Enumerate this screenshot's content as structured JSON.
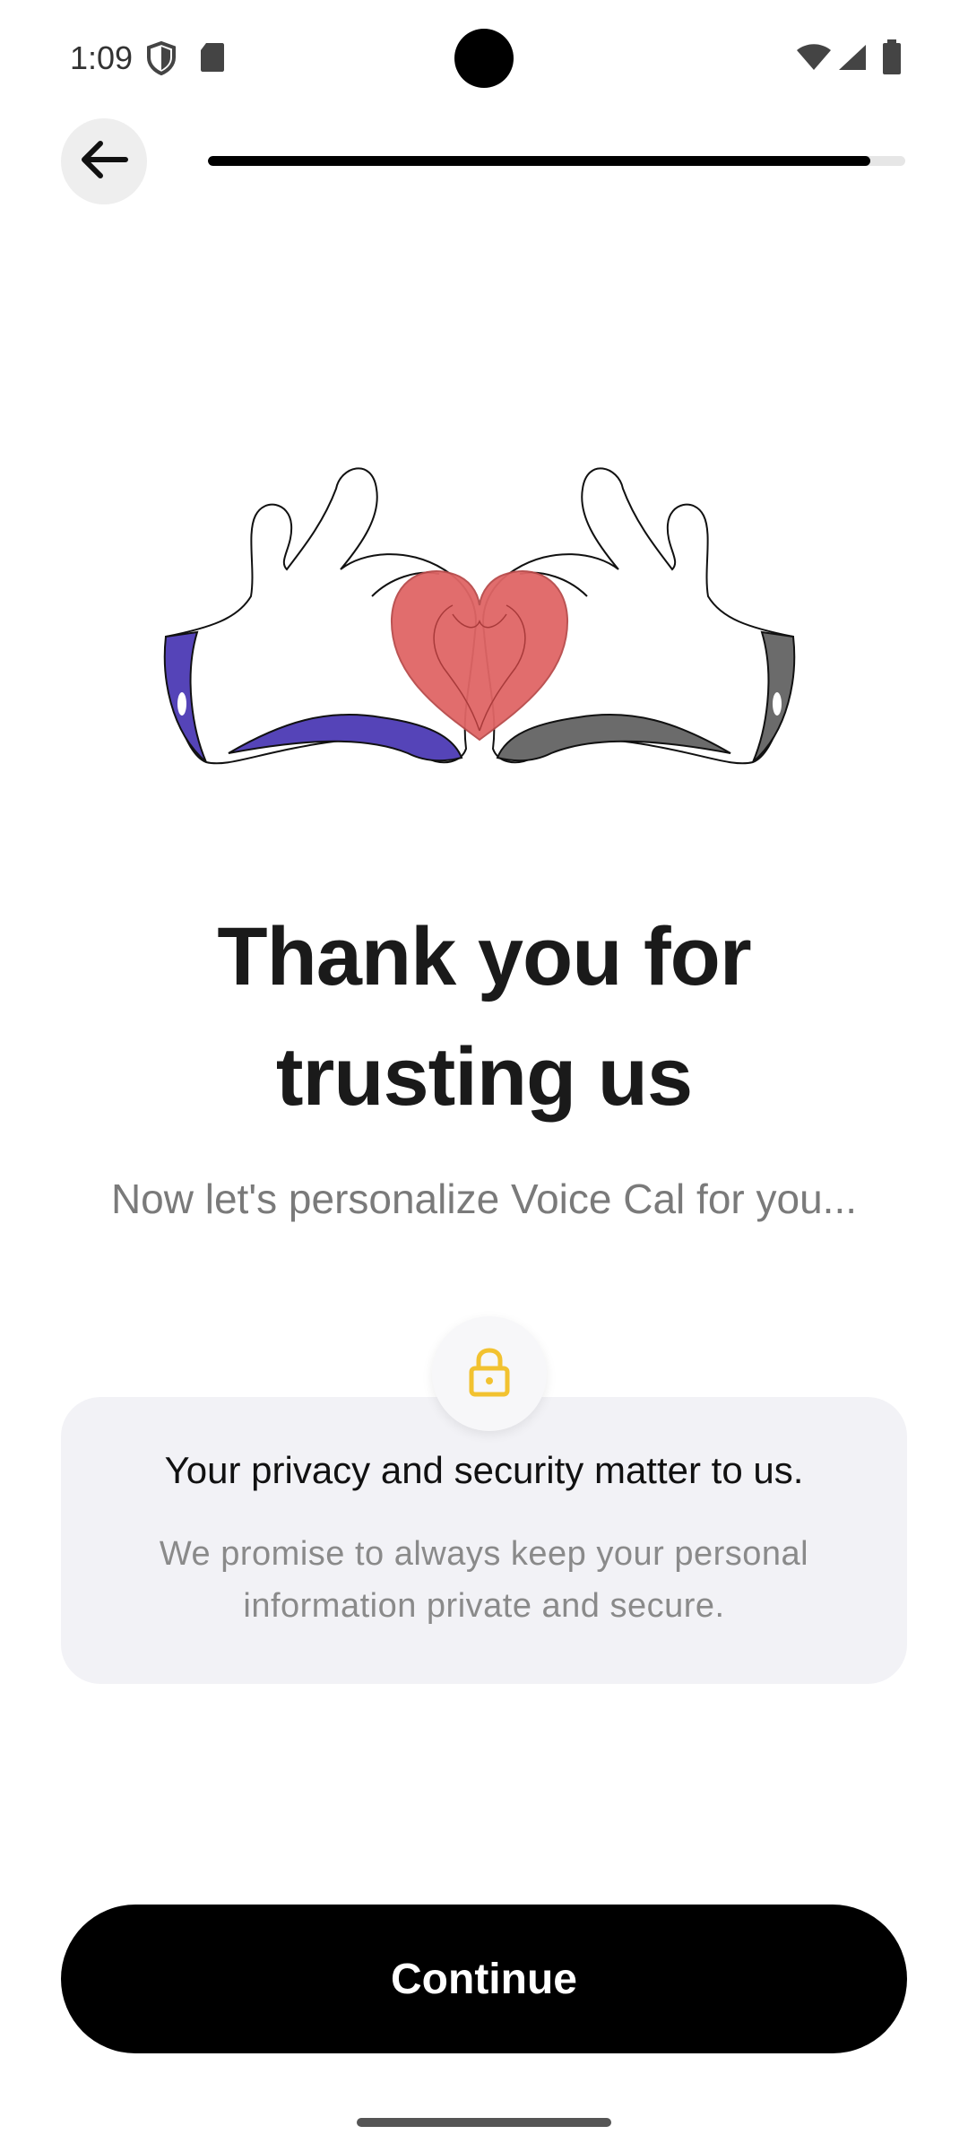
{
  "status_bar": {
    "time": "1:09",
    "icons": [
      "shield-icon",
      "sd-card-icon",
      "wifi-icon",
      "signal-icon",
      "battery-icon"
    ]
  },
  "header": {
    "back_icon": "arrow-left-icon",
    "progress_fraction": 0.95
  },
  "illustration": {
    "description_icon": "heart-hands-icon",
    "heart_color": "#E06666",
    "left_cuff_color": "#5544B8",
    "right_cuff_color": "#6B6B6B"
  },
  "main": {
    "title_line1": "Thank you for",
    "title_line2": "trusting us",
    "subtitle": "Now let's personalize Voice Cal for you..."
  },
  "privacy_card": {
    "icon": "lock-icon",
    "icon_color": "#F2C230",
    "title": "Your privacy and security matter to us.",
    "text_line1": "We promise to always keep your personal",
    "text_line2": "information private and secure."
  },
  "footer": {
    "continue_label": "Continue"
  }
}
